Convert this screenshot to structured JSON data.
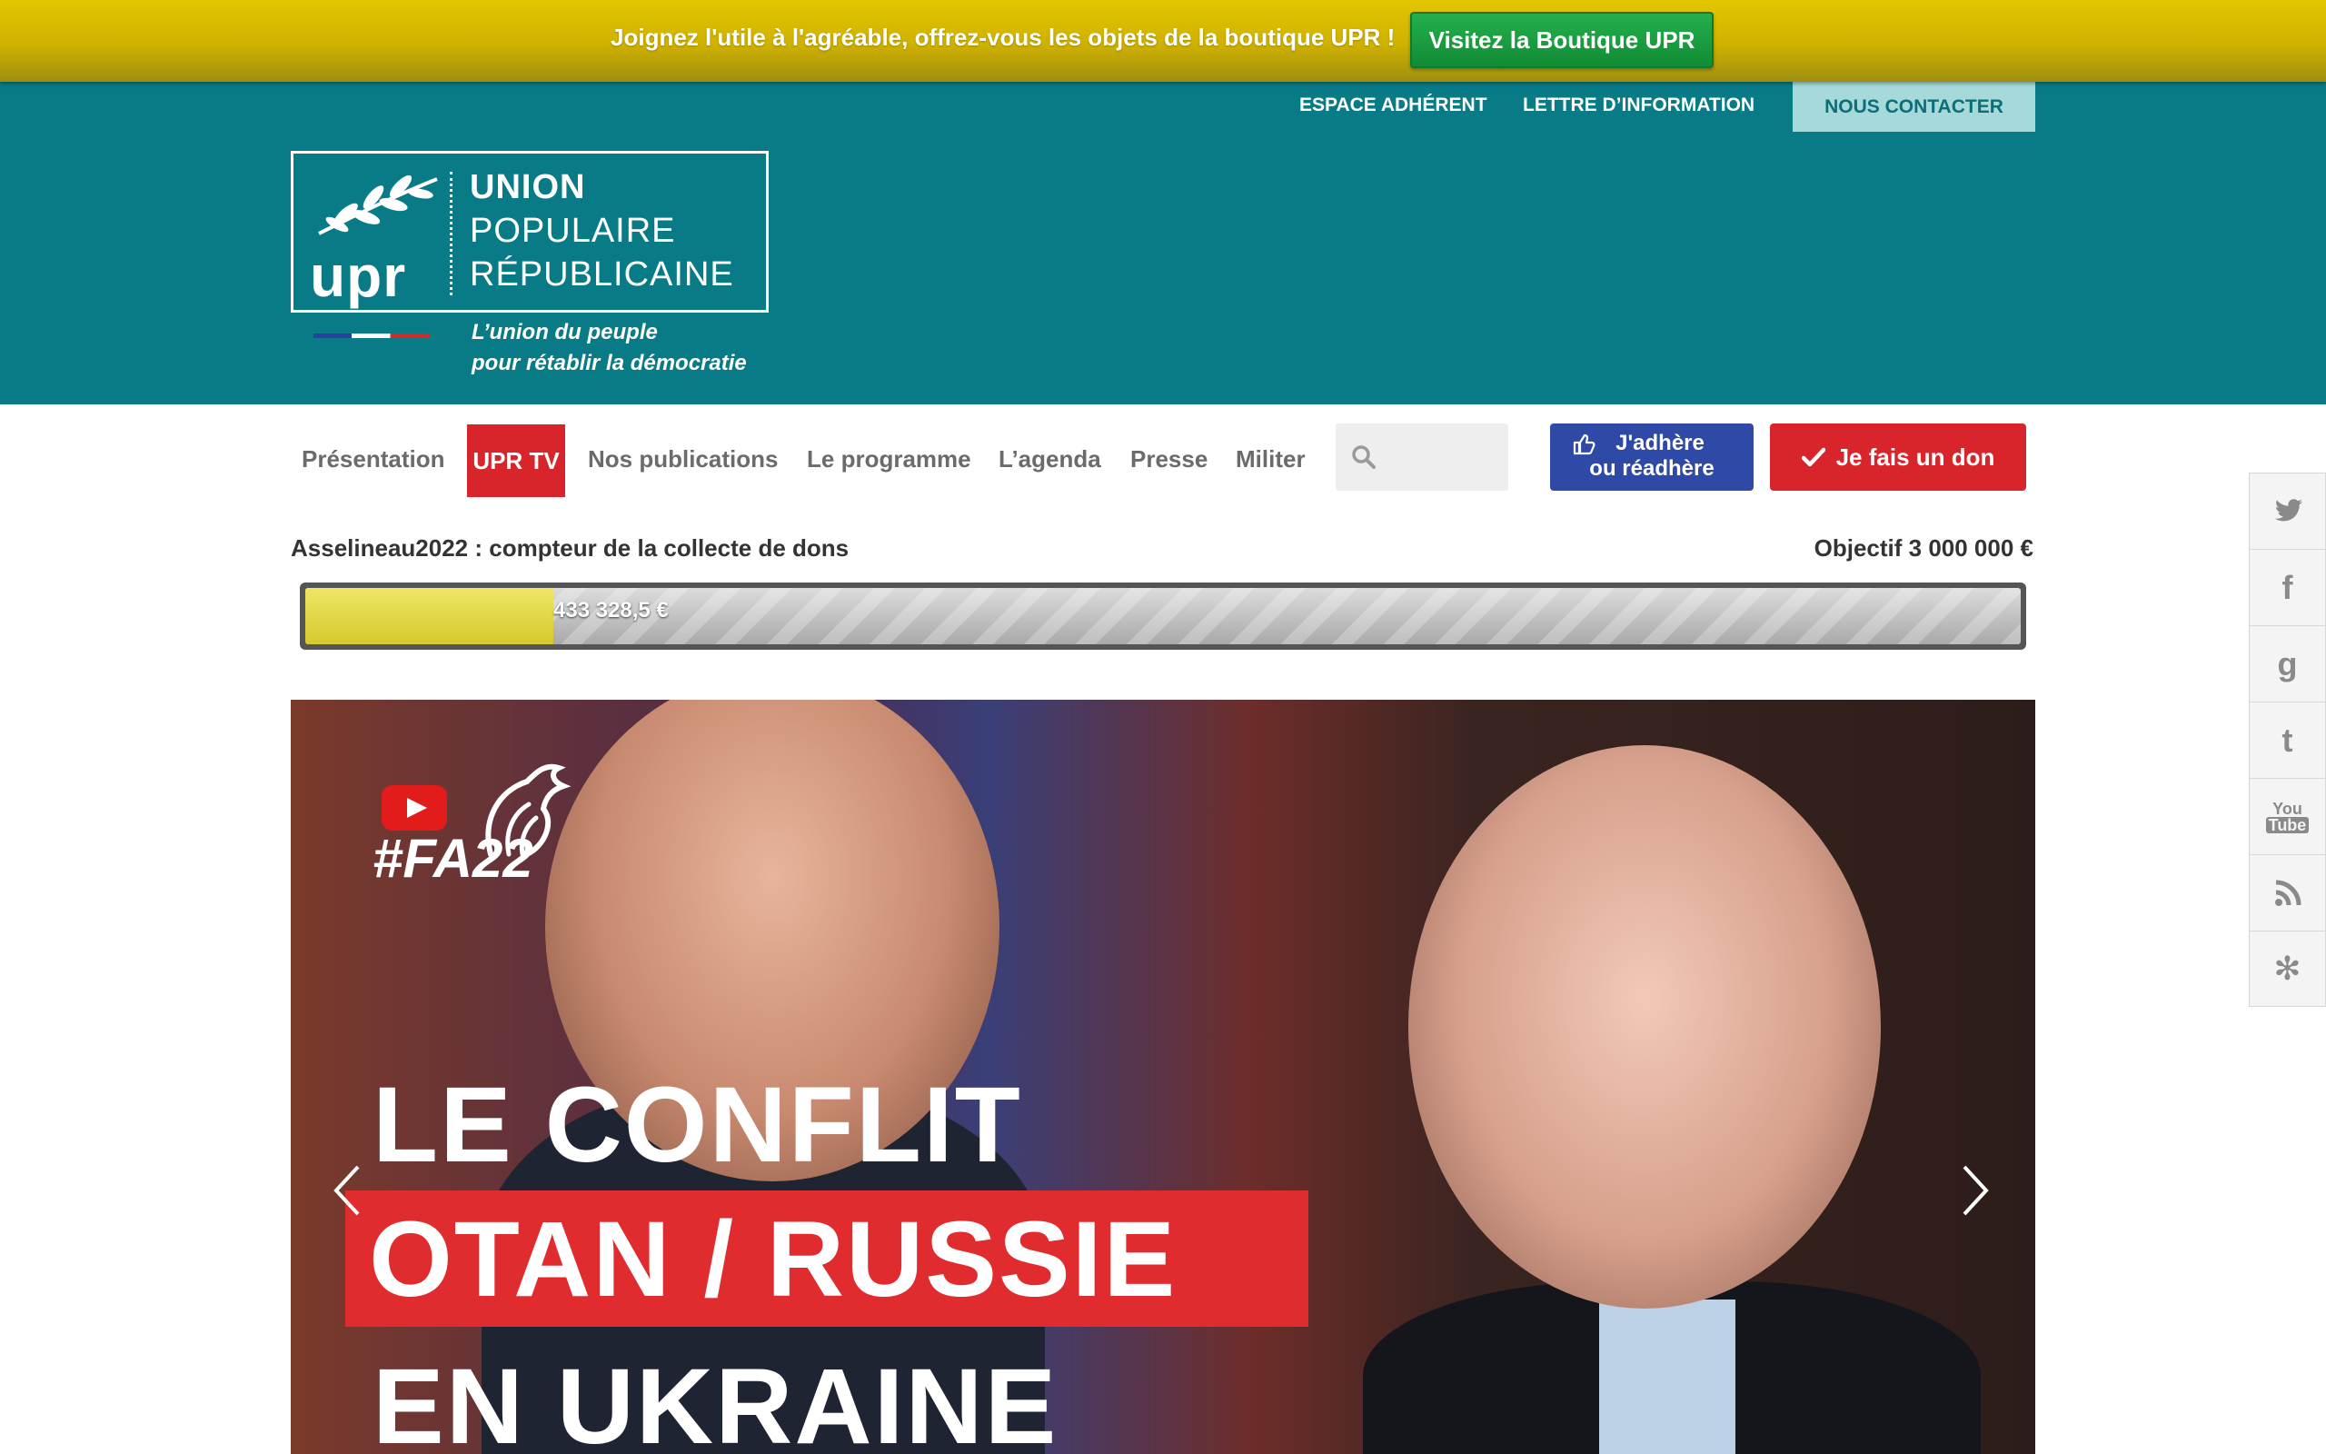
{
  "promo": {
    "text": "Joignez l'utile à l'agréable, offrez-vous les objets de la boutique UPR !",
    "button": "Visitez la Boutique UPR"
  },
  "top_links": {
    "adherent": "ESPACE ADHÉRENT",
    "lettre": "LETTRE D’INFORMATION",
    "contact": "NOUS CONTACTER"
  },
  "logo": {
    "abbr": "upr",
    "line1": "UNION",
    "line2": "POPULAIRE",
    "line3": "RÉPUBLICAINE",
    "slogan1": "L’union du peuple",
    "slogan2": "pour rétablir la démocratie"
  },
  "nav": {
    "items": [
      "Présentation",
      "UPR TV",
      "Nos publications",
      "Le programme",
      "L’agenda",
      "Presse",
      "Militer"
    ],
    "active": "UPR TV"
  },
  "search": {
    "placeholder": ""
  },
  "buttons": {
    "adhere_line1": "J'adhère",
    "adhere_line2": "ou réadhère",
    "don": "Je fais un don"
  },
  "counter": {
    "label": "Asselineau2022 : compteur de la collecte de dons",
    "goal": "Objectif 3 000 000 €",
    "value_text": "433 328,5 €",
    "value": 433328.5,
    "target": 3000000
  },
  "slide": {
    "tag": "#FA22",
    "line1": "LE CONFLIT",
    "line2": "OTAN / RUSSIE",
    "line3": "EN UKRAINE"
  },
  "social": [
    {
      "icon": "twitter-icon",
      "glyph": "🐦"
    },
    {
      "icon": "facebook-icon",
      "glyph": "f"
    },
    {
      "icon": "google-icon",
      "glyph": "g"
    },
    {
      "icon": "tumblr-icon",
      "glyph": "t"
    },
    {
      "icon": "youtube-icon",
      "glyph": "You"
    },
    {
      "icon": "rss-icon",
      "glyph": "◝"
    },
    {
      "icon": "yelp-icon",
      "glyph": "✻"
    }
  ],
  "colors": {
    "teal": "#097b86",
    "promo_yellow": "#cfb100",
    "red": "#d8252b",
    "blue": "#2f49a6",
    "green": "#1b9e3e"
  }
}
